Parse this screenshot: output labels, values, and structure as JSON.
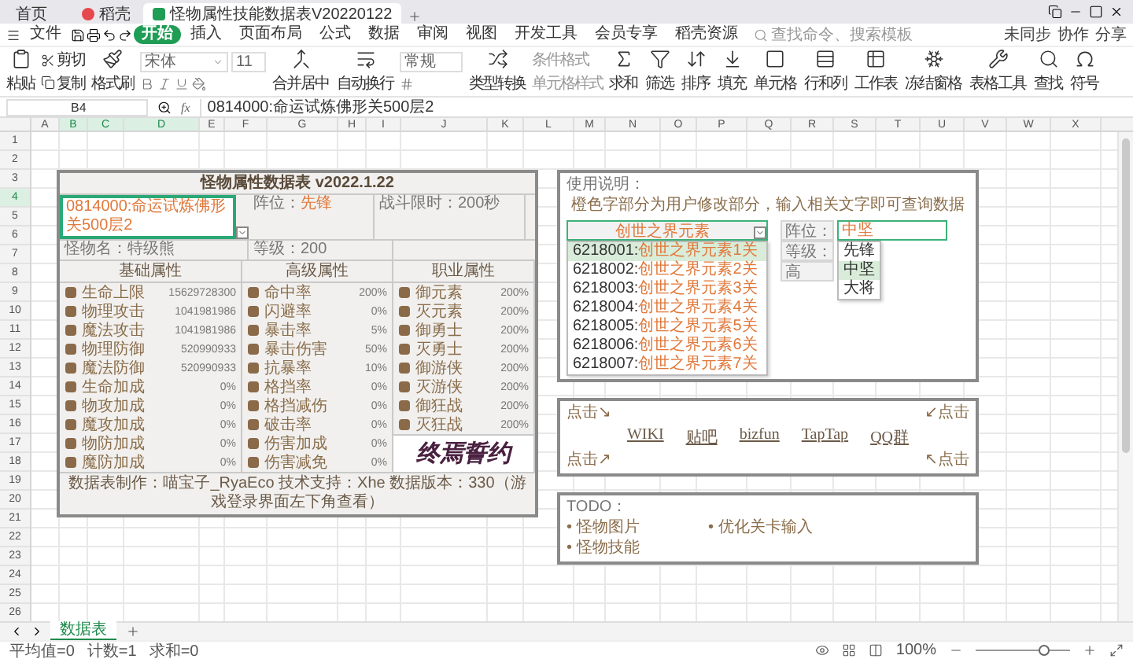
{
  "window": {
    "tabs": [
      {
        "label": "首页",
        "selected": false,
        "kind": "home"
      },
      {
        "label": "稻壳",
        "selected": false,
        "kind": "docer"
      },
      {
        "label": "怪物属性技能数据表V20220122",
        "selected": true,
        "kind": "sheet"
      }
    ]
  },
  "menu": {
    "file": "文件",
    "items": [
      {
        "label": "开始",
        "selected": true
      },
      {
        "label": "插入",
        "selected": false
      },
      {
        "label": "页面布局",
        "selected": false
      },
      {
        "label": "公式",
        "selected": false
      },
      {
        "label": "数据",
        "selected": false
      },
      {
        "label": "审阅",
        "selected": false
      },
      {
        "label": "视图",
        "selected": false
      },
      {
        "label": "开发工具",
        "selected": false
      },
      {
        "label": "会员专享",
        "selected": false
      },
      {
        "label": "稻壳资源",
        "selected": false
      }
    ],
    "search": {
      "placeholder": "查找命令、搜索模板"
    },
    "actions": [
      "未同步",
      "协作",
      "分享"
    ]
  },
  "ribbon": {
    "paste": "粘贴",
    "cut": "剪切",
    "copy": "复制",
    "format_painter": "格式刷",
    "font": "宋体",
    "font_size": "11",
    "merge": "合并居中",
    "wrap": "自动换行",
    "number_format": "常规",
    "convert": "类型转换",
    "conditional": "条件格式",
    "cell_style": "单元格样式",
    "tools": [
      "求和",
      "筛选",
      "排序",
      "填充",
      "单元格",
      "行和列",
      "工作表",
      "冻结窗格",
      "表格工具",
      "查找",
      "符号"
    ]
  },
  "formula_bar": {
    "cell": "B4",
    "fx": "fx",
    "value": "0814000:命运试炼佛形关500层2"
  },
  "columns": [
    {
      "label": "A",
      "selected": false
    },
    {
      "label": "B",
      "selected": true
    },
    {
      "label": "C",
      "selected": true
    },
    {
      "label": "D",
      "selected": true
    },
    {
      "label": "E",
      "selected": false
    },
    {
      "label": "F",
      "selected": false
    },
    {
      "label": "G",
      "selected": false
    },
    {
      "label": "H",
      "selected": false
    },
    {
      "label": "I",
      "selected": false
    },
    {
      "label": "J",
      "selected": false
    },
    {
      "label": "K",
      "selected": false
    },
    {
      "label": "L",
      "selected": false
    },
    {
      "label": "M",
      "selected": false
    },
    {
      "label": "N",
      "selected": false
    },
    {
      "label": "O",
      "selected": false
    },
    {
      "label": "P",
      "selected": false
    },
    {
      "label": "Q",
      "selected": false
    },
    {
      "label": "R",
      "selected": false
    },
    {
      "label": "S",
      "selected": false
    },
    {
      "label": "T",
      "selected": false
    },
    {
      "label": "U",
      "selected": false
    },
    {
      "label": "V",
      "selected": false
    },
    {
      "label": "W",
      "selected": false
    },
    {
      "label": "X",
      "selected": false
    }
  ],
  "rows": [
    {
      "label": "1",
      "selected": false
    },
    {
      "label": "2",
      "selected": false
    },
    {
      "label": "3",
      "selected": false
    },
    {
      "label": "4",
      "selected": true
    },
    {
      "label": "5",
      "selected": false
    },
    {
      "label": "6",
      "selected": false
    },
    {
      "label": "7",
      "selected": false
    },
    {
      "label": "8",
      "selected": false
    },
    {
      "label": "9",
      "selected": false
    },
    {
      "label": "10",
      "selected": false
    },
    {
      "label": "11",
      "selected": false
    },
    {
      "label": "12",
      "selected": false
    },
    {
      "label": "13",
      "selected": false
    },
    {
      "label": "14",
      "selected": false
    },
    {
      "label": "15",
      "selected": false
    },
    {
      "label": "16",
      "selected": false
    },
    {
      "label": "17",
      "selected": false
    },
    {
      "label": "18",
      "selected": false
    },
    {
      "label": "19",
      "selected": false
    },
    {
      "label": "20",
      "selected": false
    },
    {
      "label": "21",
      "selected": false
    },
    {
      "label": "22",
      "selected": false
    },
    {
      "label": "23",
      "selected": false
    },
    {
      "label": "24",
      "selected": false
    },
    {
      "label": "25",
      "selected": false
    },
    {
      "label": "26",
      "selected": false
    }
  ],
  "monster_table": {
    "title": "怪物属性数据表 v2022.1.22",
    "stage": "0814000:命运试炼佛形关500层2",
    "position": {
      "label": "阵位：",
      "value": "先锋"
    },
    "time_limit": "战斗限时：200秒",
    "name": "怪物名：特级熊",
    "level": "等级：200",
    "sections": [
      "基础属性",
      "高级属性",
      "职业属性"
    ],
    "basic": [
      {
        "name": "生命上限",
        "value": "15629728300"
      },
      {
        "name": "物理攻击",
        "value": "1041981986"
      },
      {
        "name": "魔法攻击",
        "value": "1041981986"
      },
      {
        "name": "物理防御",
        "value": "520990933"
      },
      {
        "name": "魔法防御",
        "value": "520990933"
      },
      {
        "name": "生命加成",
        "value": "0%"
      },
      {
        "name": "物攻加成",
        "value": "0%"
      },
      {
        "name": "魔攻加成",
        "value": "0%"
      },
      {
        "name": "物防加成",
        "value": "0%"
      },
      {
        "name": "魔防加成",
        "value": "0%"
      }
    ],
    "advanced": [
      {
        "name": "命中率",
        "value": "200%"
      },
      {
        "name": "闪避率",
        "value": "0%"
      },
      {
        "name": "暴击率",
        "value": "5%"
      },
      {
        "name": "暴击伤害",
        "value": "50%"
      },
      {
        "name": "抗暴率",
        "value": "10%"
      },
      {
        "name": "格挡率",
        "value": "0%"
      },
      {
        "name": "格挡减伤",
        "value": "0%"
      },
      {
        "name": "破击率",
        "value": "0%"
      },
      {
        "name": "伤害加成",
        "value": "0%"
      },
      {
        "name": "伤害减免",
        "value": "0%"
      }
    ],
    "job": [
      {
        "name": "御元素",
        "value": "200%"
      },
      {
        "name": "灭元素",
        "value": "200%"
      },
      {
        "name": "御勇士",
        "value": "200%"
      },
      {
        "name": "灭勇士",
        "value": "200%"
      },
      {
        "name": "御游侠",
        "value": "200%"
      },
      {
        "name": "灭游侠",
        "value": "200%"
      },
      {
        "name": "御狂战",
        "value": "200%"
      },
      {
        "name": "灭狂战",
        "value": "200%"
      }
    ],
    "logo": "终焉誓约",
    "footer": "数据表制作：喵宝子_RyaEco  技术支持：Xhe  数据版本：330（游戏登录界面左下角查看）"
  },
  "usage": {
    "title": "使用说明：",
    "instruction": "橙色字部分为用户修改部分，输入相关文字即可查询数据",
    "stage_field": "创世之界元素",
    "stage_options": [
      {
        "code": "6218001:",
        "name": "创世之界元素1关",
        "selected": true
      },
      {
        "code": "6218002:",
        "name": "创世之界元素2关",
        "selected": false
      },
      {
        "code": "6218003:",
        "name": "创世之界元素3关",
        "selected": false
      },
      {
        "code": "6218004:",
        "name": "创世之界元素4关",
        "selected": false
      },
      {
        "code": "6218005:",
        "name": "创世之界元素5关",
        "selected": false
      },
      {
        "code": "6218006:",
        "name": "创世之界元素6关",
        "selected": false
      },
      {
        "code": "6218007:",
        "name": "创世之界元素7关",
        "selected": false
      }
    ],
    "position_label": "阵位：",
    "position_field": "中坚",
    "position_options": [
      {
        "label": "先锋",
        "selected": false
      },
      {
        "label": "中坚",
        "selected": true
      },
      {
        "label": "大将",
        "selected": false
      }
    ],
    "level_label": "等级：",
    "header_partial": "高"
  },
  "links": {
    "corners": [
      "点击↘",
      "↙点击",
      "点击↗",
      "↖点击"
    ],
    "items": [
      "WIKI",
      "贴吧",
      "bizfun",
      "TapTap",
      "QQ群"
    ]
  },
  "todo": {
    "title": "TODO：",
    "items": [
      "• 怪物图片",
      "• 优化关卡输入",
      "• 怪物技能"
    ]
  },
  "sheet_tabs": [
    {
      "label": "数据表",
      "selected": true
    }
  ],
  "status_bar": {
    "stats": [
      "平均值=0",
      "计数=1",
      "求和=0"
    ],
    "zoom": "100%",
    "zoom_slider": {
      "level": 0.72
    }
  }
}
